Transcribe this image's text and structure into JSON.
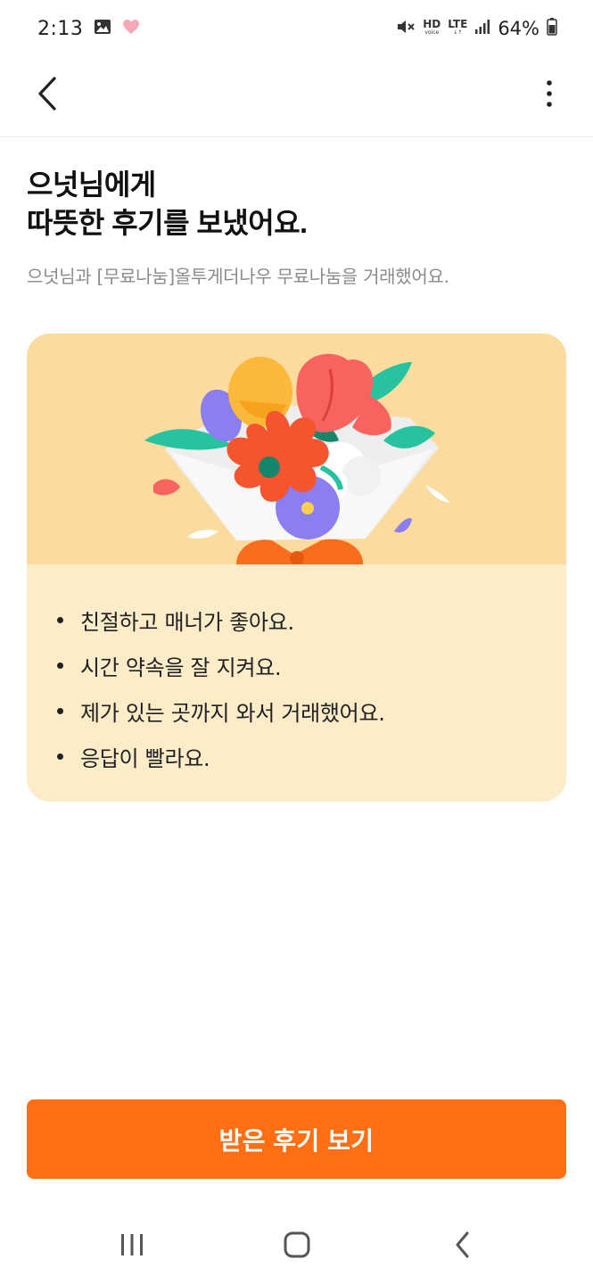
{
  "status_bar": {
    "time": "2:13",
    "hd_label": "HD",
    "hd_sub": "voice",
    "network": "LTE",
    "battery": "64%"
  },
  "app_bar": {
    "back_icon": "chevron-left-icon",
    "more_icon": "more-vertical-icon"
  },
  "header": {
    "title_line1": "으넛님에게",
    "title_line2": "따뜻한 후기를 보냈어요.",
    "subtitle": "으넛님과 [무료나눔]올투게더나우 무료나눔을 거래했어요."
  },
  "review_card": {
    "illustration": "flower-bouquet-illustration",
    "items": [
      "친절하고 매너가 좋아요.",
      "시간 약속을 잘 지켜요.",
      "제가 있는 곳까지 와서 거래했어요.",
      "응답이 빨라요."
    ]
  },
  "primary_button": {
    "label": "받은 후기 보기"
  },
  "colors": {
    "accent": "#fd6f12",
    "card_bg": "#fdecc8",
    "illustration_bg": "#fcdc9e"
  }
}
